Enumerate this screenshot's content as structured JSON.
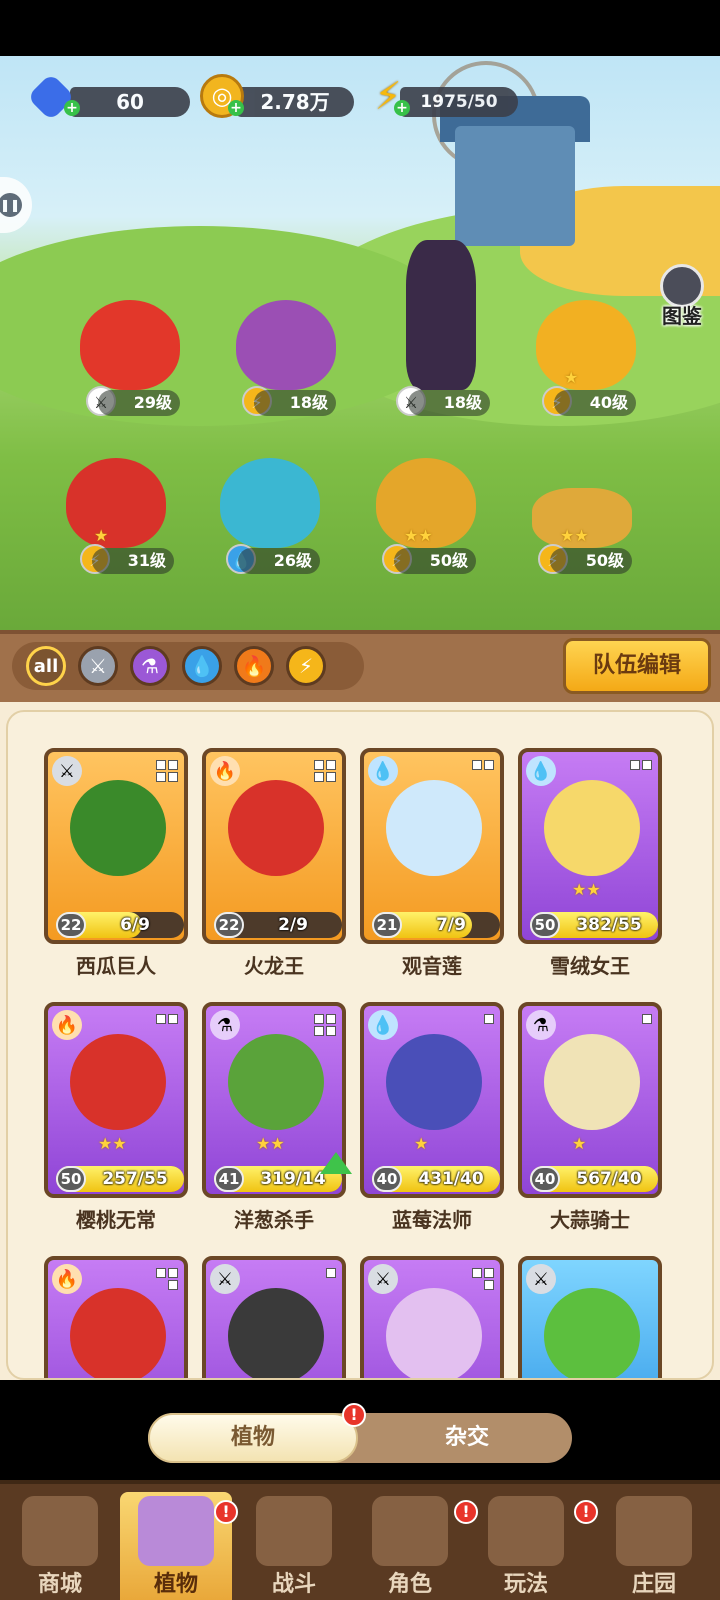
{
  "resources": {
    "diamond": "60",
    "gold": "2.78万",
    "energy": "1975/50"
  },
  "atlas_label": "图鉴",
  "team": [
    {
      "level": "29级",
      "element": "sword-icon"
    },
    {
      "level": "18级",
      "element": "lightning-icon"
    },
    {
      "level": "18级",
      "element": "sword-icon"
    },
    {
      "level": "40级",
      "element": "lightning-icon"
    },
    {
      "level": "31级",
      "element": "lightning-icon"
    },
    {
      "level": "26级",
      "element": "water-icon"
    },
    {
      "level": "50级",
      "element": "lightning-icon"
    },
    {
      "level": "50级",
      "element": "lightning-icon"
    }
  ],
  "filters": [
    "all",
    "sword",
    "poison",
    "water",
    "fire",
    "lightning"
  ],
  "filter_all_label": "all",
  "team_edit_label": "队伍编辑",
  "cards": [
    {
      "name": "西瓜巨人",
      "level": "22",
      "progress": "6/9",
      "fill": 0.67,
      "color": "gold"
    },
    {
      "name": "火龙王",
      "level": "22",
      "progress": "2/9",
      "fill": 0.22,
      "color": "gold"
    },
    {
      "name": "观音莲",
      "level": "21",
      "progress": "7/9",
      "fill": 0.78,
      "color": "gold"
    },
    {
      "name": "雪绒女王",
      "level": "50",
      "progress": "382/55",
      "fill": 1.0,
      "color": "purple"
    },
    {
      "name": "樱桃无常",
      "level": "50",
      "progress": "257/55",
      "fill": 1.0,
      "color": "purple"
    },
    {
      "name": "洋葱杀手",
      "level": "41",
      "progress": "319/14",
      "fill": 1.0,
      "color": "purple"
    },
    {
      "name": "蓝莓法师",
      "level": "40",
      "progress": "431/40",
      "fill": 1.0,
      "color": "purple"
    },
    {
      "name": "大蒜骑士",
      "level": "40",
      "progress": "567/40",
      "fill": 1.0,
      "color": "purple"
    }
  ],
  "toggle": {
    "plants": "植物",
    "hybrid": "杂交"
  },
  "nav": [
    "商城",
    "植物",
    "战斗",
    "角色",
    "玩法",
    "庄园"
  ],
  "badge": "!"
}
